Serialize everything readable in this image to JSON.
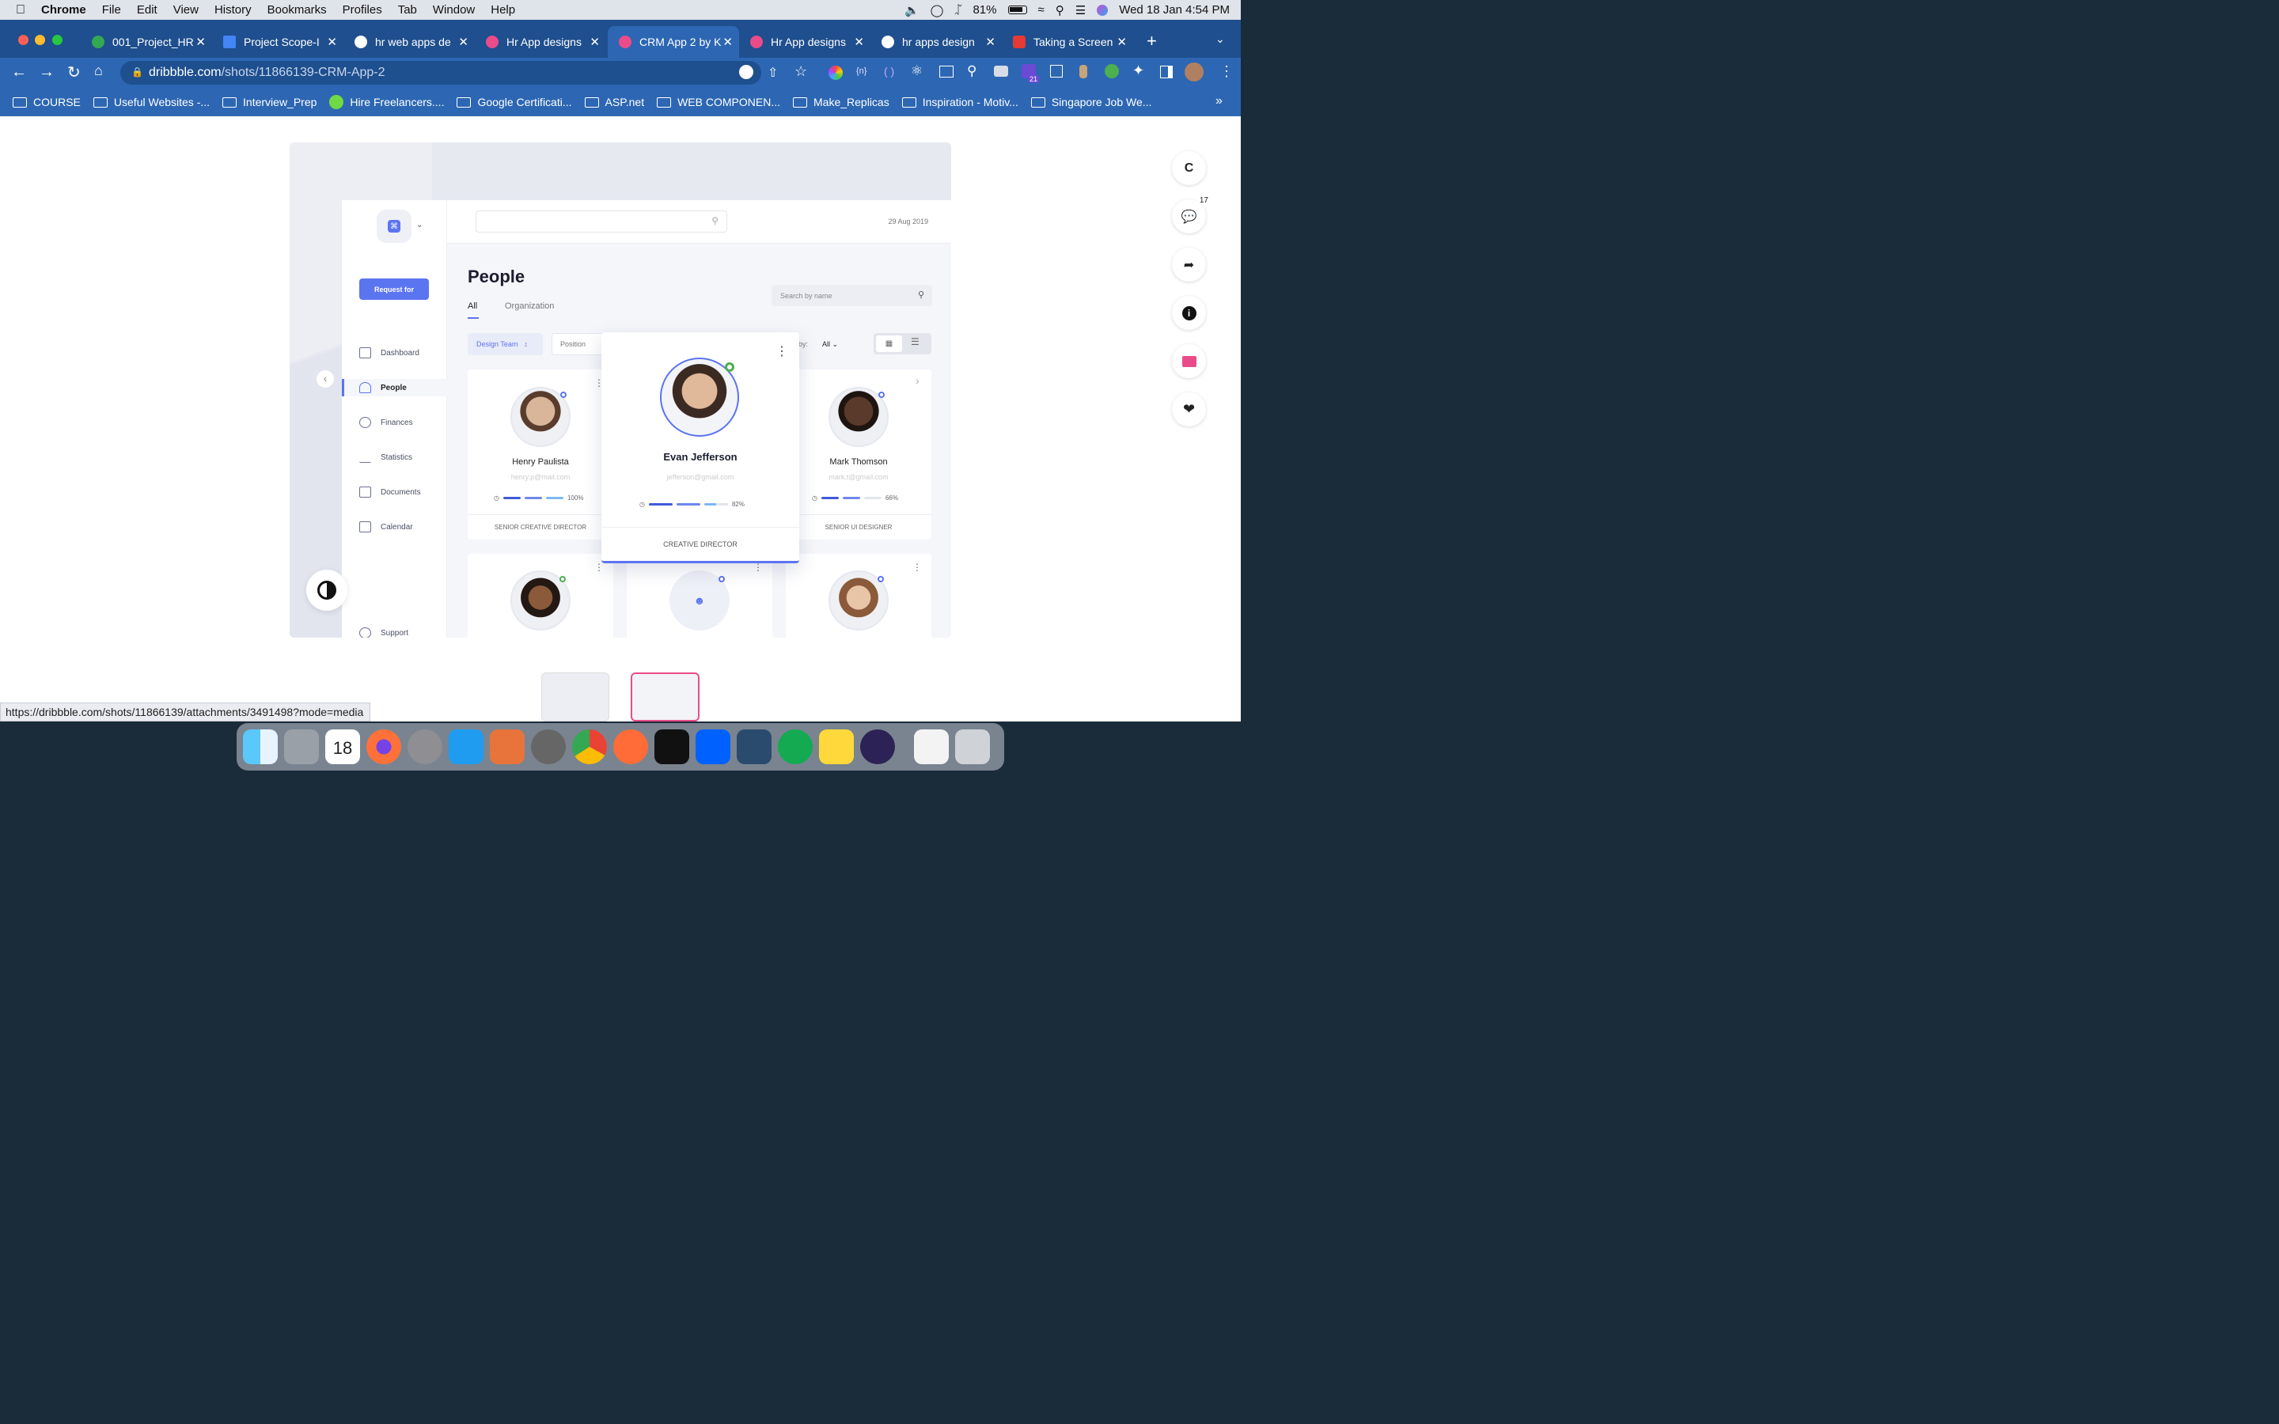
{
  "menubar": {
    "app": "Chrome",
    "items": [
      "File",
      "Edit",
      "View",
      "History",
      "Bookmarks",
      "Profiles",
      "Tab",
      "Window",
      "Help"
    ],
    "battery": "81%",
    "datetime": "Wed 18 Jan  4:54 PM"
  },
  "tabs": [
    {
      "label": "001_Project_HR",
      "color": "#34a853"
    },
    {
      "label": "Project Scope-I",
      "color": "#4285f4"
    },
    {
      "label": "hr web apps de",
      "color": "#ffffff"
    },
    {
      "label": "Hr App designs",
      "color": "#ea4c89"
    },
    {
      "label": "CRM App 2 by K",
      "color": "#ea4c89"
    },
    {
      "label": "Hr App designs",
      "color": "#ea4c89"
    },
    {
      "label": "hr apps design",
      "color": "#ffffff"
    },
    {
      "label": "Taking a Screen",
      "color": "#e53935"
    }
  ],
  "url": {
    "host": "dribbble.com",
    "path": "/shots/11866139-CRM-App-2"
  },
  "bookmarks": [
    "COURSE",
    "Useful Websites -...",
    "Interview_Prep",
    "Hire Freelancers....",
    "Google Certificati...",
    "ASP.net",
    "WEB COMPONEN...",
    "Make_Replicas",
    "Inspiration - Motiv...",
    "Singapore Job We..."
  ],
  "crm": {
    "date": "29 Aug 2019",
    "request_btn": "Request for",
    "nav": [
      "Dashboard",
      "People",
      "Finances",
      "Statistics",
      "Documents",
      "Calendar"
    ],
    "support": "Support",
    "title": "People",
    "tabs": [
      "All",
      "Organization"
    ],
    "search_placeholder": "Search by name",
    "filter_team": "Design Team",
    "filter_position": "Position",
    "sort_label": "t by:",
    "sort_value": "All",
    "people": [
      {
        "name": "Henry Paulista",
        "email": "henry.p@mail.com",
        "pct": "100%",
        "role": "SENIOR CREATIVE DIRECTOR"
      },
      {
        "name": "Evan Jefferson",
        "email": "jefferson@gmail.com",
        "pct": "82%",
        "role": "CREATIVE DIRECTOR"
      },
      {
        "name": "Mark Thomson",
        "email": "mark.t@gmail.com",
        "pct": "66%",
        "role": "SENIOR UI DESIGNER"
      }
    ]
  },
  "side_actions": {
    "avatar_letter": "C",
    "comments": "17"
  },
  "status_url": "https://dribbble.com/shots/11866139/attachments/3491498?mode=media"
}
